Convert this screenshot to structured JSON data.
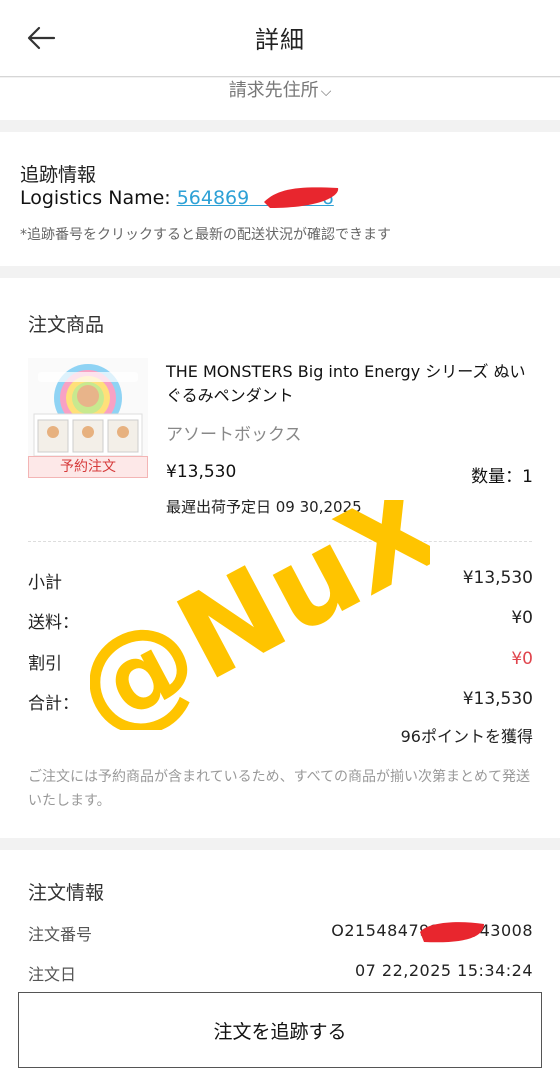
{
  "header": {
    "title": "詳細",
    "back_icon": "arrow-left-icon"
  },
  "billing": {
    "label": "請求先住所",
    "chevron": "⌵"
  },
  "tracking": {
    "title": "追跡情報",
    "logistics_label": "Logistics Name:",
    "tracking_number": "564869",
    "note": "*追跡番号をクリックすると最新の配送状況が確認できます"
  },
  "products": {
    "title": "注文商品",
    "items": [
      {
        "name": "THE MONSTERS Big into Energy シリーズ ぬいぐるみペンダント",
        "variant": "アソートボックス",
        "tag": "予約注文",
        "price": "¥13,530",
        "quantity": "数量：1",
        "ship_date": "最遅出荷予定日 09 30,2025"
      }
    ],
    "summary": {
      "subtotal_label": "小計",
      "subtotal_value": "¥13,530",
      "shipping_label": "送料：",
      "shipping_value": "¥0",
      "discount_label": "割引",
      "discount_value": "¥0",
      "total_label": "合計：",
      "total_value": "¥13,530",
      "points": "96ポイントを獲得"
    },
    "note": "ご注文には予約商品が含まれているため、すべての商品が揃い次第まとめて発送いたします。"
  },
  "order_info": {
    "title": "注文情報",
    "number_label": "注文番号",
    "number_value": "O215484791       43008",
    "date_label": "注文日",
    "date_value": "07 22,2025 15:34:24"
  },
  "actions": {
    "track_label": "注文を追跡する"
  },
  "watermark": {
    "text": "@NuX"
  },
  "colors": {
    "link": "#2ea1d6",
    "discount": "#e0454d",
    "tag": "#d63b3b",
    "watermark": "#ffc400",
    "redaction": "#e8262e"
  }
}
